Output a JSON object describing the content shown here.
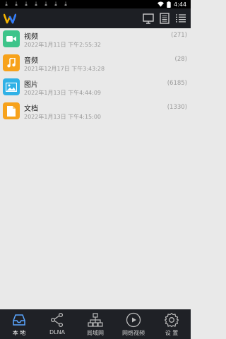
{
  "status_bar": {
    "time": "4:44",
    "notification_icons": [
      "download-icon",
      "download-icon",
      "download-icon",
      "download-icon",
      "download-icon",
      "download-icon",
      "download-icon"
    ]
  },
  "app_bar": {
    "actions": [
      "screen-icon",
      "document-list-icon",
      "menu-list-icon"
    ]
  },
  "media_list": [
    {
      "name": "视频",
      "date": "2022年1月11日 下午2:55:32",
      "count": "(271)",
      "icon": "video-camera-icon",
      "color": "#3dc48a"
    },
    {
      "name": "音频",
      "date": "2021年12月17日 下午3:43:28",
      "count": "(28)",
      "icon": "music-note-icon",
      "color": "#f7a21b"
    },
    {
      "name": "图片",
      "date": "2022年1月13日 下午4:44:09",
      "count": "(6185)",
      "icon": "image-icon",
      "color": "#2fb1e6"
    },
    {
      "name": "文档",
      "date": "2022年1月13日 下午4:15:00",
      "count": "(1330)",
      "icon": "document-icon",
      "color": "#f7a21b"
    }
  ],
  "bottom_nav": [
    {
      "label": "本 地",
      "icon": "inbox-tray-icon",
      "active": true
    },
    {
      "label": "DLNA",
      "icon": "share-icon",
      "active": false
    },
    {
      "label": "局域网",
      "icon": "network-icon",
      "active": false
    },
    {
      "label": "网络视频",
      "icon": "play-circle-icon",
      "active": false
    },
    {
      "label": "设 置",
      "icon": "gear-icon",
      "active": false
    }
  ]
}
